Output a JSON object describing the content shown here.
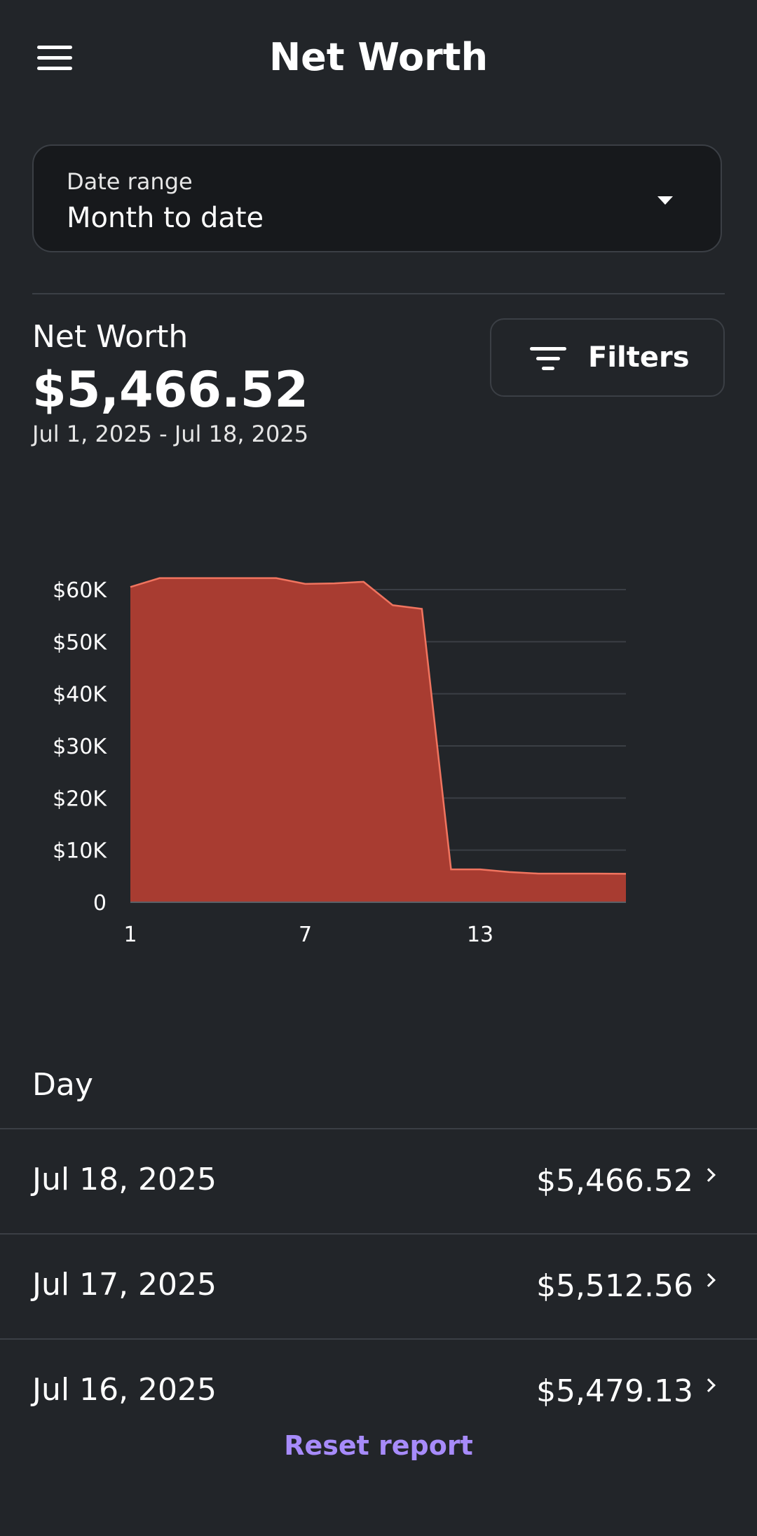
{
  "header": {
    "title": "Net Worth"
  },
  "date_range": {
    "label": "Date range",
    "value": "Month to date"
  },
  "summary": {
    "label": "Net Worth",
    "value": "$5,466.52",
    "range": "Jul 1, 2025 - Jul 18, 2025",
    "filters_label": "Filters"
  },
  "chart_data": {
    "type": "area",
    "x": [
      1,
      2,
      3,
      4,
      5,
      6,
      7,
      8,
      9,
      10,
      11,
      12,
      13,
      14,
      15,
      16,
      17,
      18
    ],
    "values": [
      60500,
      62200,
      62200,
      62200,
      62200,
      62200,
      61100,
      61200,
      61500,
      57000,
      56300,
      6300,
      6300,
      5800,
      5500,
      5500,
      5500,
      5466.52
    ],
    "x_ticks": [
      1,
      7,
      13
    ],
    "x_tick_labels": [
      "1",
      "7",
      "13"
    ],
    "y_ticks": [
      0,
      10000,
      20000,
      30000,
      40000,
      50000,
      60000
    ],
    "y_tick_labels": [
      "0",
      "$10K",
      "$20K",
      "$30K",
      "$40K",
      "$50K",
      "$60K"
    ],
    "xlim": [
      1,
      18
    ],
    "ylim": [
      0,
      60000
    ],
    "grid": true,
    "colors": {
      "fill": "#a83c31",
      "line": "#f0745f",
      "grid": "#3b3f45",
      "axis": "#5a5f66"
    }
  },
  "list": {
    "header": "Day",
    "rows": [
      {
        "date": "Jul 18, 2025",
        "amount": "$5,466.52"
      },
      {
        "date": "Jul 17, 2025",
        "amount": "$5,512.56"
      },
      {
        "date": "Jul 16, 2025",
        "amount": "$5,479.13"
      }
    ]
  },
  "footer": {
    "reset_label": "Reset report"
  },
  "icons": {
    "menu": "hamburger-menu-icon",
    "dropdown": "caret-down-icon",
    "filter": "filter-lines-icon",
    "chevron": "chevron-right-icon"
  },
  "colors": {
    "background": "#222529",
    "accent": "#a78bfa"
  }
}
